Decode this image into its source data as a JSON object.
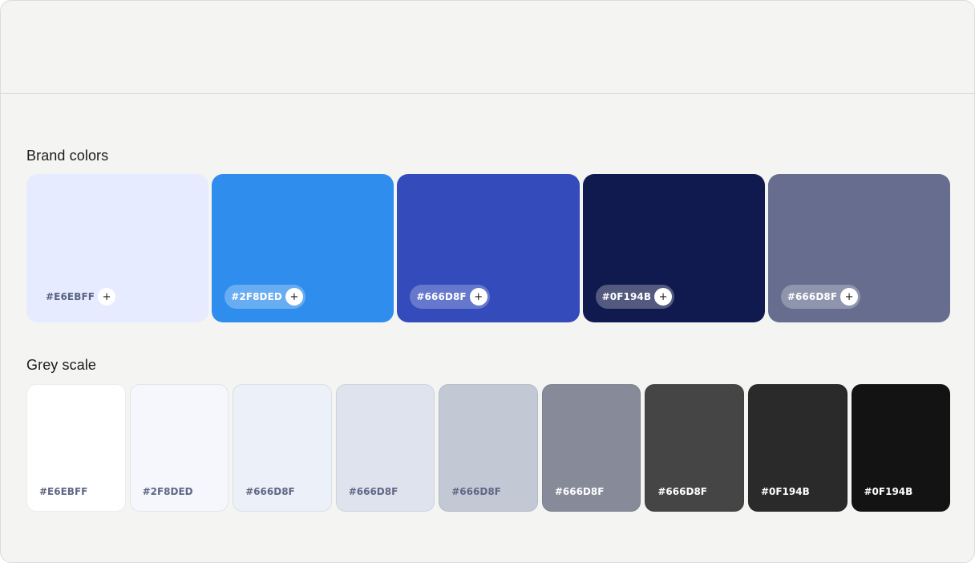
{
  "brand_section": {
    "title": "Brand colors",
    "swatches": [
      {
        "label": "#E6EBFF",
        "color": "#E6EBFF",
        "text_color": "#5a6382",
        "chip_bg": "transparent"
      },
      {
        "label": "#2F8DED",
        "color": "#2F8DED",
        "text_color": "#ffffff",
        "chip_bg": "rgba(255,255,255,0.28)"
      },
      {
        "label": "#666D8F",
        "color": "#334BBB",
        "text_color": "#ffffff",
        "chip_bg": "rgba(255,255,255,0.25)"
      },
      {
        "label": "#0F194B",
        "color": "#111A4E",
        "text_color": "#ffffff",
        "chip_bg": "rgba(255,255,255,0.28)"
      },
      {
        "label": "#666D8F",
        "color": "#666D8F",
        "text_color": "#ffffff",
        "chip_bg": "rgba(255,255,255,0.28)"
      }
    ],
    "add_symbol": "+"
  },
  "grey_section": {
    "title": "Grey scale",
    "swatches": [
      {
        "label": "#E6EBFF",
        "color": "#FFFFFF",
        "text_color": "#5f6785"
      },
      {
        "label": "#2F8DED",
        "color": "#F5F7FC",
        "text_color": "#5f6785"
      },
      {
        "label": "#666D8F",
        "color": "#ECF0F8",
        "text_color": "#5f6785"
      },
      {
        "label": "#666D8F",
        "color": "#DEE3EE",
        "text_color": "#5f6785"
      },
      {
        "label": "#666D8F",
        "color": "#C3C8D5",
        "text_color": "#5f6785"
      },
      {
        "label": "#666D8F",
        "color": "#878A98",
        "text_color": "#ffffff"
      },
      {
        "label": "#666D8F",
        "color": "#454545",
        "text_color": "#ffffff"
      },
      {
        "label": "#0F194B",
        "color": "#2A2A2A",
        "text_color": "#ffffff"
      },
      {
        "label": "#0F194B",
        "color": "#131313",
        "text_color": "#ffffff"
      }
    ]
  }
}
